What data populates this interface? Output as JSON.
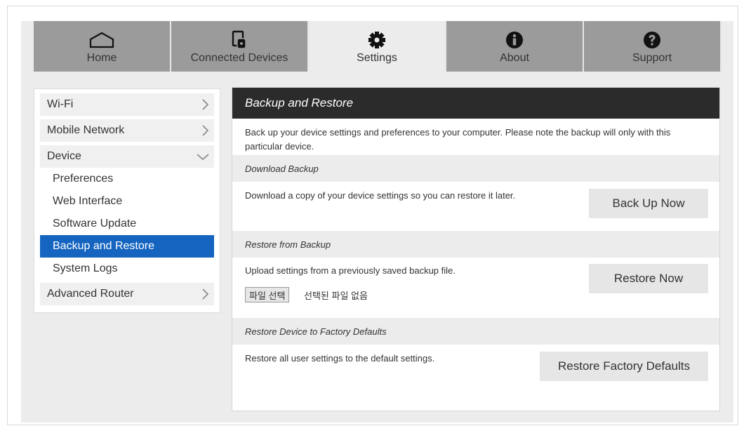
{
  "tabs": [
    {
      "label": "Home",
      "icon": "home-icon"
    },
    {
      "label": "Connected Devices",
      "icon": "connected-devices-icon"
    },
    {
      "label": "Settings",
      "icon": "gear-icon"
    },
    {
      "label": "About",
      "icon": "info-icon"
    },
    {
      "label": "Support",
      "icon": "question-icon"
    }
  ],
  "active_tab": "Settings",
  "sidebar": {
    "wifi": "Wi-Fi",
    "mobile_network": "Mobile Network",
    "device": "Device",
    "device_items": [
      "Preferences",
      "Web Interface",
      "Software Update",
      "Backup and Restore",
      "System Logs"
    ],
    "active_item": "Backup and Restore",
    "advanced_router": "Advanced Router"
  },
  "panel": {
    "title": "Backup and Restore",
    "description": "Back up your device settings and preferences to your computer. Please note the backup will only with this particular device.",
    "download": {
      "heading": "Download Backup",
      "text": "Download a copy of your device settings so you can restore it later.",
      "button": "Back Up Now"
    },
    "restore": {
      "heading": "Restore from Backup",
      "text": "Upload settings from a previously saved backup file.",
      "file_button": "파일 선택",
      "file_status": "선택된 파일 없음",
      "button": "Restore Now"
    },
    "factory": {
      "heading": "Restore Device to Factory Defaults",
      "text": "Restore all user settings to the default settings.",
      "button": "Restore Factory Defaults"
    }
  },
  "colors": {
    "tab_inactive": "#9b9b9b",
    "tab_active": "#ececec",
    "panel_header": "#2b2b2b",
    "selected_item": "#1565c0"
  }
}
